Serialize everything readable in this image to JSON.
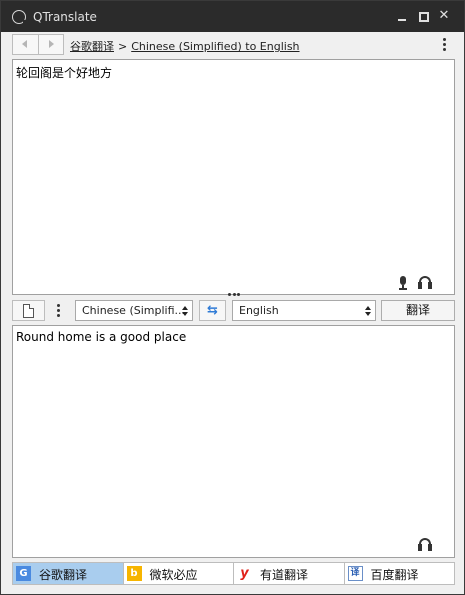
{
  "window": {
    "title": "QTranslate"
  },
  "toolbar": {
    "service_link": "谷歌翻译",
    "separator": ">",
    "direction_link": "Chinese (Simplified) to English"
  },
  "source": {
    "text": "轮回阁是个好地方"
  },
  "controls": {
    "source_lang": "Chinese (Simplifi...",
    "swap_glyph": "⇆",
    "target_lang": "English",
    "translate_label": "翻译"
  },
  "target": {
    "text": "Round home is a good place"
  },
  "services": [
    {
      "label": "谷歌翻译",
      "logo": "G",
      "active": true
    },
    {
      "label": "微软必应",
      "logo": "b",
      "active": false
    },
    {
      "label": "有道翻译",
      "logo": "y",
      "active": false
    },
    {
      "label": "百度翻译",
      "logo": "译",
      "active": false
    }
  ],
  "colors": {
    "titlebar": "#2b2b2b",
    "active_tab": "#a9cdee",
    "swap_accent": "#2f7bd6"
  }
}
